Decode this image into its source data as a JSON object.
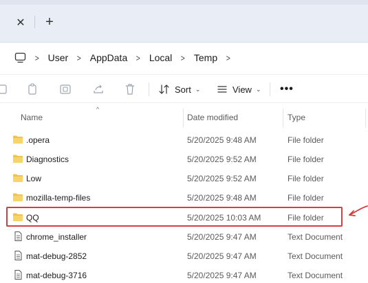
{
  "tabbar": {
    "close_glyph": "✕",
    "add_glyph": "+"
  },
  "breadcrumb": {
    "items": [
      "User",
      "AppData",
      "Local",
      "Temp"
    ]
  },
  "toolbar": {
    "sort_label": "Sort",
    "view_label": "View",
    "more_glyph": "•••"
  },
  "columns": {
    "name": "Name",
    "date_modified": "Date modified",
    "type": "Type"
  },
  "files": [
    {
      "name": ".opera",
      "date": "5/20/2025 9:48 AM",
      "type": "File folder",
      "kind": "folder"
    },
    {
      "name": "Diagnostics",
      "date": "5/20/2025 9:52 AM",
      "type": "File folder",
      "kind": "folder"
    },
    {
      "name": "Low",
      "date": "5/20/2025 9:52 AM",
      "type": "File folder",
      "kind": "folder"
    },
    {
      "name": "mozilla-temp-files",
      "date": "5/20/2025 9:48 AM",
      "type": "File folder",
      "kind": "folder"
    },
    {
      "name": "QQ",
      "date": "5/20/2025 10:03 AM",
      "type": "File folder",
      "kind": "folder",
      "highlighted": true
    },
    {
      "name": "chrome_installer",
      "date": "5/20/2025 9:47 AM",
      "type": "Text Document",
      "kind": "document"
    },
    {
      "name": "mat-debug-2852",
      "date": "5/20/2025 9:47 AM",
      "type": "Text Document",
      "kind": "document"
    },
    {
      "name": "mat-debug-3716",
      "date": "5/20/2025 9:47 AM",
      "type": "Text Document",
      "kind": "document"
    }
  ],
  "colors": {
    "folder": "#f2c14e",
    "highlight": "#d93a3a"
  }
}
